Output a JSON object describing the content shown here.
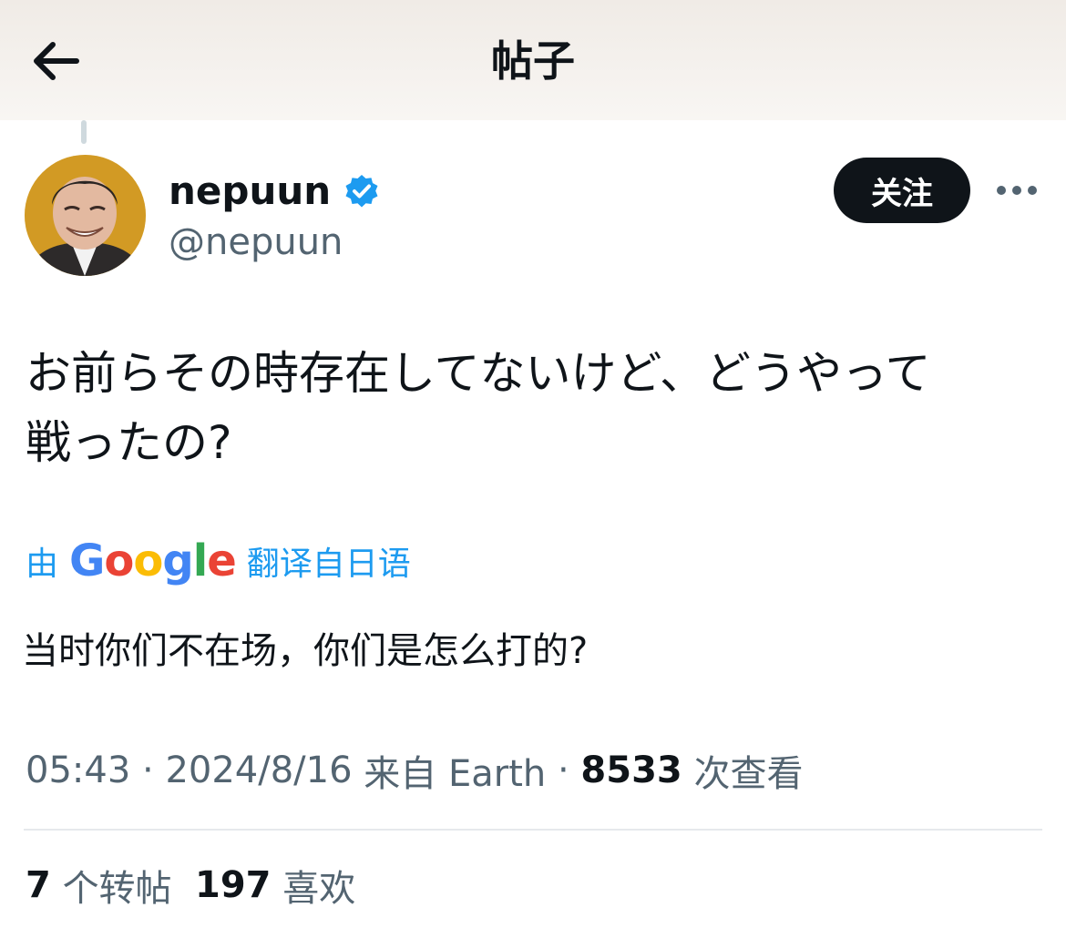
{
  "header": {
    "title": "帖子",
    "back_icon": "arrow-left-icon"
  },
  "author": {
    "display_name": "nepuun",
    "handle": "@nepuun",
    "verified_icon": "verified-badge-icon",
    "verified_color": "#1d9bf0"
  },
  "follow_button": {
    "label": "关注"
  },
  "more_icon": "more-horizontal-icon",
  "tweet": {
    "text": "お前らその時存在してないけど、どうやって\n戦ったの?"
  },
  "translation": {
    "prefix": "由",
    "logo_letters": [
      "G",
      "o",
      "o",
      "g",
      "l",
      "e"
    ],
    "logo_colors": [
      "#4285F4",
      "#EA4335",
      "#FBBC05",
      "#4285F4",
      "#34A853",
      "#EA4335"
    ],
    "suffix": "翻译自日语",
    "text": "当时你们不在场，你们是怎么打的?"
  },
  "meta": {
    "time": "05:43",
    "separator": " · ",
    "date": "2024/8/16",
    "source": "来自 Earth",
    "views": "8533",
    "views_label": "次查看"
  },
  "stats": {
    "reposts": "7",
    "reposts_label": "个转帖",
    "likes": "197",
    "likes_label": "喜欢"
  },
  "colors": {
    "accent": "#1d9bf0",
    "text": "#0f1419",
    "secondary": "#536471"
  }
}
